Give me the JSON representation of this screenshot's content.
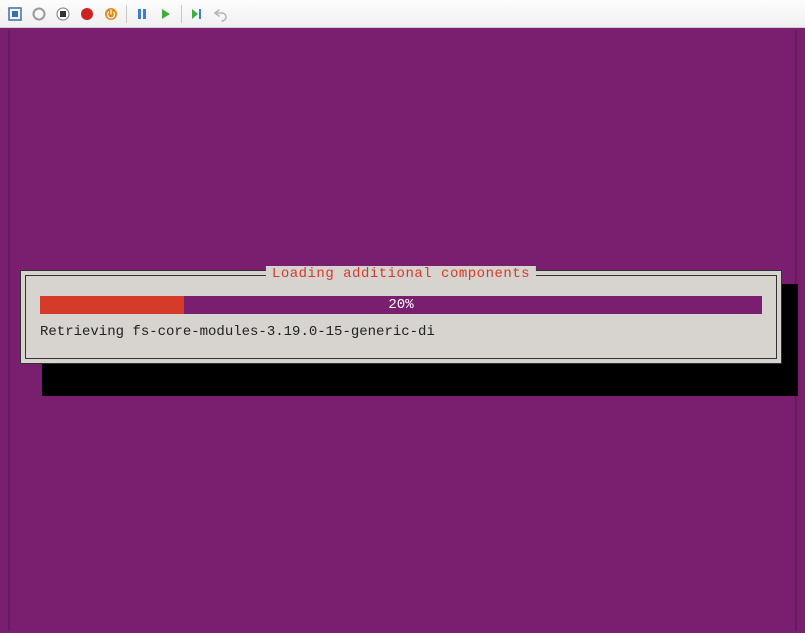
{
  "toolbar": {
    "items": [
      {
        "name": "manager-icon"
      },
      {
        "name": "circle-gray-icon"
      },
      {
        "name": "stop-icon"
      },
      {
        "name": "record-icon"
      },
      {
        "name": "power-icon"
      },
      {
        "sep": true
      },
      {
        "name": "pause-icon"
      },
      {
        "name": "play-icon"
      },
      {
        "sep": true
      },
      {
        "name": "step-icon"
      },
      {
        "name": "undo-icon"
      }
    ]
  },
  "installer": {
    "title": "Loading additional components",
    "progress_percent": 20,
    "progress_label": "20%",
    "status": "Retrieving fs-core-modules-3.19.0-15-generic-di"
  },
  "colors": {
    "bg": "#7a1f6f",
    "accent_red": "#d43b28",
    "panel": "#d7d3cf"
  }
}
